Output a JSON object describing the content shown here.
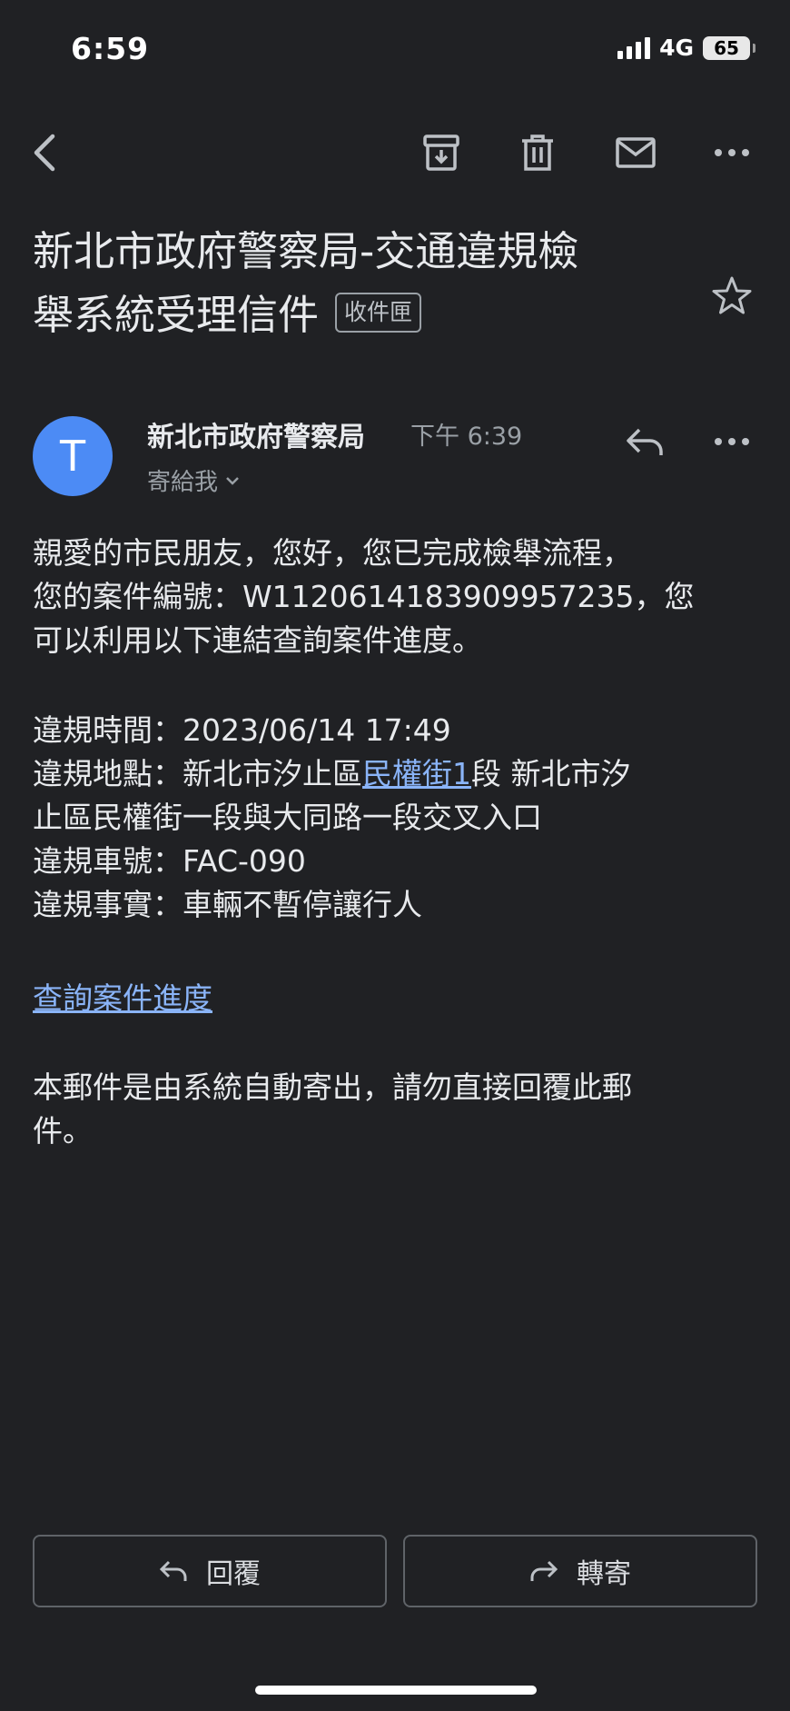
{
  "status_bar": {
    "time": "6:59",
    "network": "4G",
    "battery": "65"
  },
  "toolbar": {
    "icons": [
      "back-arrow-icon",
      "archive-icon",
      "trash-icon",
      "mail-icon",
      "more-icon"
    ]
  },
  "email": {
    "subject_line1": "新北市政府警察局-交通違規檢",
    "subject_line2": "舉系統受理信件",
    "label": "收件匣",
    "sender": {
      "initial": "T",
      "name": "新北市政府警察局",
      "time": "下午 6:39",
      "to": "寄給我"
    },
    "body": {
      "intro_line1": "親愛的市民朋友，您好，您已完成檢舉流程，",
      "intro_line2": "您的案件編號：W1120614183909957235，您",
      "intro_line3": "可以利用以下連結查詢案件進度。",
      "time_line": "違規時間：2023/06/14 17:49",
      "location_prefix": "違規地點：新北市汐止區",
      "location_link": "民權街1",
      "location_suffix": "段 新北市汐",
      "location_line2": "止區民權街一段與大同路一段交叉入口",
      "plate_line": "違規車號：FAC-090",
      "fact_line": "違規事實：車輛不暫停讓行人",
      "query_link": "查詢案件進度",
      "footer_line1": "本郵件是由系統自動寄出，請勿直接回覆此郵",
      "footer_line2": "件。"
    }
  },
  "actions": {
    "reply": "回覆",
    "forward": "轉寄"
  },
  "colors": {
    "background": "#202124",
    "text": "#e8eaed",
    "link": "#8ab4f8",
    "avatar": "#4c8bf5",
    "muted": "#9aa0a6"
  }
}
